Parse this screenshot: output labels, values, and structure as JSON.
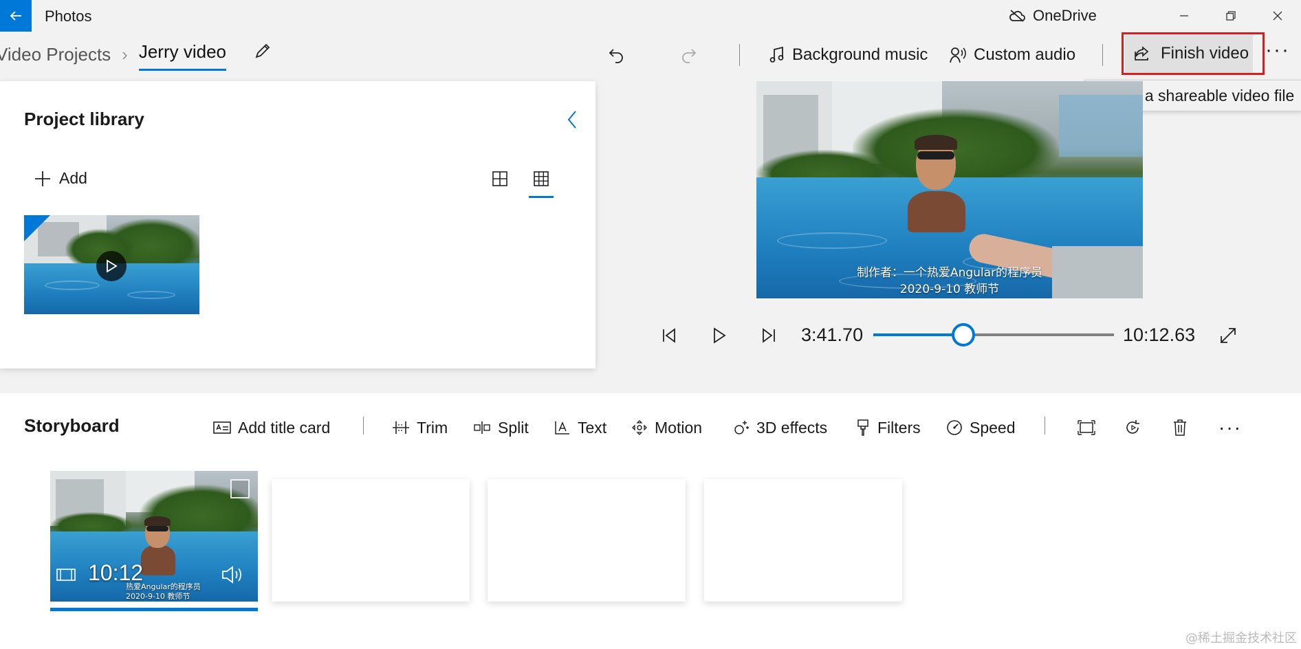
{
  "app": {
    "title": "Photos",
    "onedrive_label": "OneDrive"
  },
  "breadcrumb": {
    "parent": "Video Projects",
    "separator": "›",
    "current": "Jerry video"
  },
  "toolbar": {
    "background_music": "Background music",
    "custom_audio": "Custom audio",
    "finish_video": "Finish video",
    "more": "···",
    "finish_tooltip": "Export a shareable video file"
  },
  "library": {
    "title": "Project library",
    "add_label": "Add"
  },
  "preview": {
    "caption_line1": "制作者：一个热爱Angular的程序员",
    "caption_line2": "2020-9-10 教师节",
    "current_time": "3:41.70",
    "total_time": "10:12.63",
    "progress_fraction": 0.374
  },
  "storyboard": {
    "title": "Storyboard",
    "commands": {
      "add_title_card": "Add title card",
      "trim": "Trim",
      "split": "Split",
      "text": "Text",
      "motion": "Motion",
      "effects_3d": "3D effects",
      "filters": "Filters",
      "speed": "Speed",
      "more": "···"
    },
    "clip": {
      "duration": "10:12",
      "caption_line1": "热爱Angular的程序员",
      "caption_line2": "2020-9-10 教师节"
    }
  },
  "watermark": "@稀土掘金技术社区",
  "colors": {
    "accent": "#0078d7",
    "highlight_border": "#d32020"
  }
}
